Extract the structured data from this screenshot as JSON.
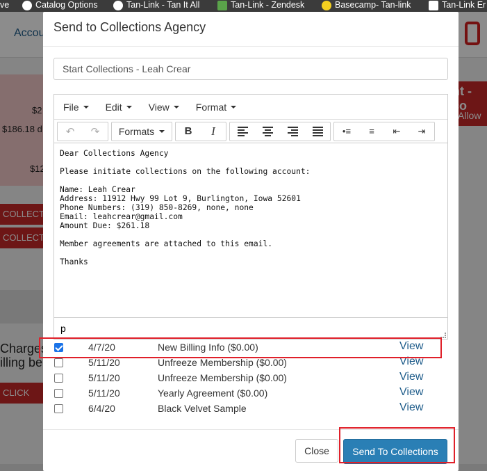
{
  "bookmarks": [
    {
      "label": "ve"
    },
    {
      "label": "Catalog Options"
    },
    {
      "label": "Tan-Link - Tan It All"
    },
    {
      "label": "Tan-Link - Zendesk"
    },
    {
      "label": "Basecamp- Tan-link"
    },
    {
      "label": "Tan-Link Er"
    }
  ],
  "background": {
    "account_tab": "Accou",
    "amounts": [
      "$2",
      "$186.18 d",
      "$12"
    ],
    "collect_buttons": [
      "COLLECT",
      "COLLECT"
    ],
    "charges_text": [
      "Charges",
      "illing be"
    ],
    "click_button": "CLICK HE",
    "right_banner": "nt - co",
    "allow_button": "Allow"
  },
  "modal": {
    "title": "Send to Collections Agency",
    "subject_value": "Start Collections - Leah Crear",
    "menu": [
      "File",
      "Edit",
      "View",
      "Format"
    ],
    "toolbar": {
      "formats_label": "Formats",
      "bold": "B",
      "italic": "I"
    },
    "body_lines": [
      "Dear Collections Agency",
      "",
      "Please initiate collections on the following account:",
      "",
      "Name: Leah Crear",
      "Address: 11912 Hwy 99 Lot 9, Burlington, Iowa 52601",
      "Phone Numbers: (319) 850-8269, none, none",
      "Email: leahcrear@gmail.com",
      "Amount Due: $261.18",
      "",
      "Member agreements are attached to this email.",
      "",
      "Thanks"
    ],
    "status_path": "p",
    "attachments": [
      {
        "checked": true,
        "date": "4/7/20",
        "desc": "New Billing Info ($0.00)",
        "link": "View"
      },
      {
        "checked": false,
        "date": "5/11/20",
        "desc": "Unfreeze Membership ($0.00)",
        "link": "View"
      },
      {
        "checked": false,
        "date": "5/11/20",
        "desc": "Unfreeze Membership ($0.00)",
        "link": "View"
      },
      {
        "checked": false,
        "date": "5/11/20",
        "desc": "Yearly Agreement ($0.00)",
        "link": "View"
      },
      {
        "checked": false,
        "date": "6/4/20",
        "desc": "Black Velvet Sample",
        "link": "View"
      }
    ],
    "close_label": "Close",
    "send_label": "Send To Collections"
  },
  "colors": {
    "primary": "#2a7fb5",
    "highlight": "#e0202a",
    "link": "#1e5c8a"
  }
}
